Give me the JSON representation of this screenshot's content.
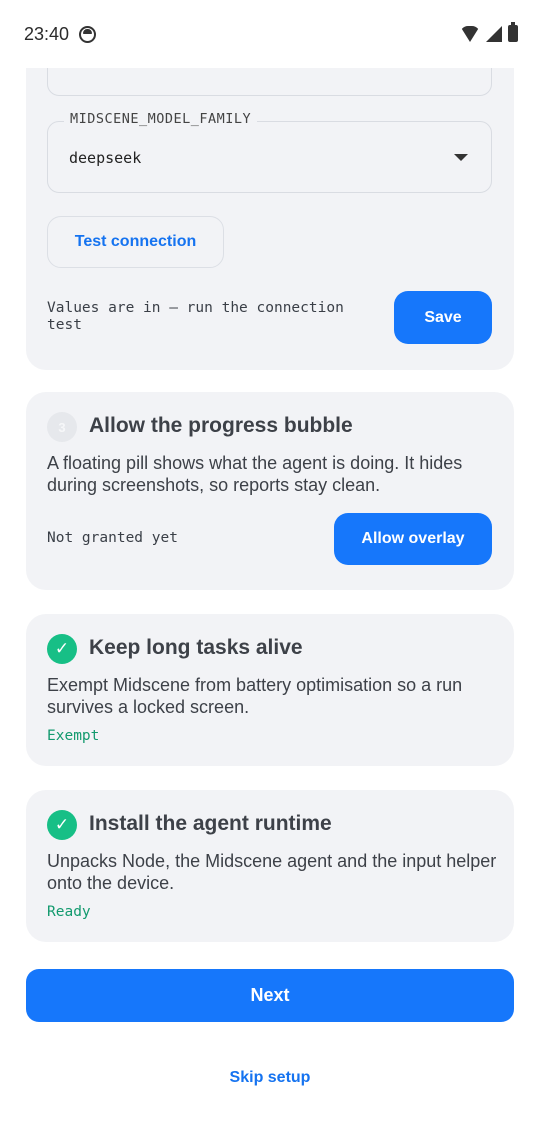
{
  "status_bar": {
    "time": "23:40",
    "icons": [
      "face-notification-icon",
      "wifi-icon",
      "cell-signal-icon",
      "battery-icon"
    ]
  },
  "model_card": {
    "previous_field_value": "...",
    "model_family_label": "MIDSCENE_MODEL_FAMILY",
    "model_family_value": "deepseek",
    "test_connection_label": "Test connection",
    "hint": "Values are in — run the connection test",
    "save_label": "Save"
  },
  "steps": [
    {
      "badge": "3",
      "title": "Allow the progress bubble",
      "description": "A floating pill shows what the agent is doing. It hides during screenshots, so reports stay clean.",
      "status": "Not granted yet",
      "action_label": "Allow overlay",
      "done": false
    },
    {
      "badge": "✓",
      "title": "Keep long tasks alive",
      "description": "Exempt Midscene from battery optimisation so a run survives a locked screen.",
      "status": "Exempt",
      "done": true
    },
    {
      "badge": "✓",
      "title": "Install the agent runtime",
      "description": "Unpacks Node, the Midscene agent and the input helper onto the device.",
      "status": "Ready",
      "done": true
    }
  ],
  "footer": {
    "next_label": "Next",
    "skip_label": "Skip setup"
  },
  "colors": {
    "accent": "#1677fb",
    "success": "#17bf86",
    "success_text": "#139a6e",
    "card_background": "#f2f3f6"
  }
}
